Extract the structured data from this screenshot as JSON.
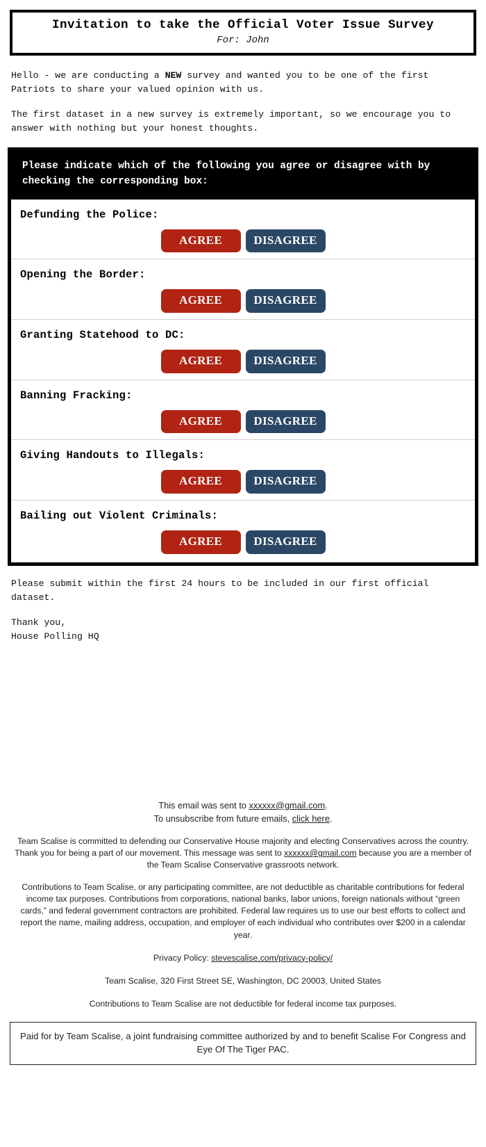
{
  "header": {
    "title": "Invitation to take the Official Voter Issue Survey",
    "recipient_line": "For: John"
  },
  "intro": {
    "paragraph1_part1": "Hello - we are conducting a ",
    "paragraph1_emphasis": "NEW",
    "paragraph1_part2": " survey and wanted you to be one of the first Patriots to share your valued opinion with us.",
    "paragraph2": "The first dataset in a new survey is extremely important, so we encourage you to answer with nothing but your honest thoughts."
  },
  "survey": {
    "instruction": "Please indicate which of the following you agree or disagree with by checking the corresponding box:",
    "agree_label": "AGREE",
    "disagree_label": "DISAGREE",
    "agree_color": "#b12313",
    "disagree_color": "#2a4766",
    "questions": [
      {
        "label": "Defunding the Police:"
      },
      {
        "label": "Opening the Border:"
      },
      {
        "label": "Granting Statehood to DC:"
      },
      {
        "label": "Banning Fracking:"
      },
      {
        "label": "Giving Handouts to Illegals:"
      },
      {
        "label": "Bailing out Violent Criminals:"
      }
    ]
  },
  "closing": {
    "deadline": "Please submit within the first 24 hours to be included in our first official dataset.",
    "signoff_line1": "Thank you,",
    "signoff_line2": "House Polling HQ"
  },
  "footer": {
    "sent_to_prefix": "This email was sent to ",
    "sent_to_email": "xxxxxx@gmail.com",
    "sent_to_suffix": ".",
    "unsubscribe_prefix": "To unsubscribe from future emails, ",
    "unsubscribe_link": "click here",
    "unsubscribe_suffix": ".",
    "mission_part1": "Team Scalise is committed to defending our Conservative House majority and electing Conservatives across the country. Thank you for being a part of our movement. This message was sent to ",
    "mission_email": "xxxxxx@gmail.com",
    "mission_part2": " because you are a member of the Team Scalise Conservative grassroots network.",
    "legal_disclaimer": "Contributions to Team Scalise, or any participating committee, are not deductible as charitable contributions for federal income tax purposes. Contributions from corporations, national banks, labor unions, foreign nationals without “green cards,” and federal government contractors are prohibited. Federal law requires us to use our best efforts to collect and report the name, mailing address, occupation, and employer of each individual who contributes over $200 in a calendar year.",
    "privacy_prefix": "Privacy Policy: ",
    "privacy_link": "stevescalise.com/privacy-policy/",
    "address": "Team Scalise, 320 First Street SE, Washington, DC 20003, United States",
    "tax_note": "Contributions to Team Scalise are not deductible for federal income tax purposes.",
    "paid_for_by": "Paid for by Team Scalise, a joint fundraising committee authorized by and to benefit Scalise For Congress and Eye Of The Tiger PAC."
  }
}
